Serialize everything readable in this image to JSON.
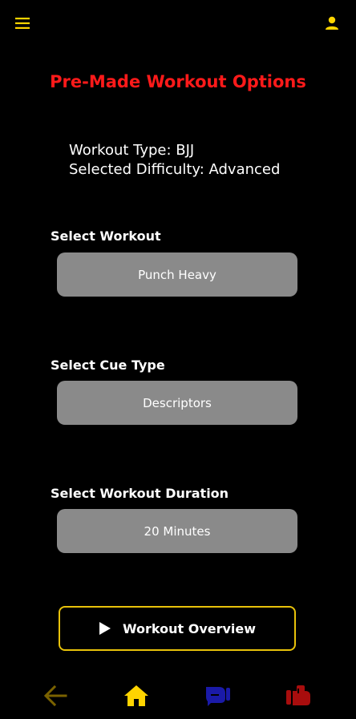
{
  "title": "Pre-Made Workout Options",
  "info": {
    "workout_type": "Workout Type: BJJ",
    "difficulty": "Selected Difficulty: Advanced"
  },
  "sections": {
    "workout": {
      "label": "Select Workout",
      "value": "Punch Heavy"
    },
    "cue_type": {
      "label": "Select Cue Type",
      "value": "Descriptors"
    },
    "duration": {
      "label": "Select Workout Duration",
      "value": "20 Minutes"
    }
  },
  "overview_button": {
    "label": "Workout Overview"
  },
  "icons": {
    "menu": "menu-icon",
    "profile": "person-icon",
    "back": "arrow-left-icon",
    "home": "home-icon",
    "nav_blue": "boxing-glove-icon",
    "nav_red": "glove-icon"
  },
  "colors": {
    "background": "#000000",
    "title": "#ff1a1a",
    "accent": "#ffd400",
    "back_arrow": "#7a6200",
    "select_bg": "#8a8a8a",
    "nav_blue": "#1a1aa8",
    "nav_red": "#a80d0d"
  }
}
